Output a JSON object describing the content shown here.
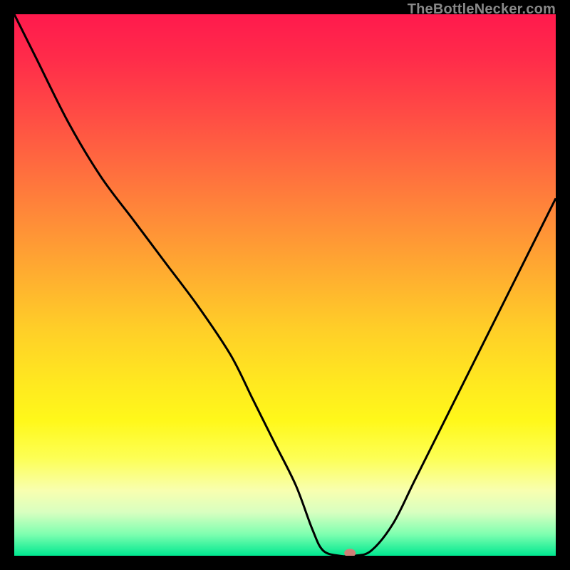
{
  "attribution": "TheBottleNecker.com",
  "chart_data": {
    "type": "line",
    "title": "",
    "xlabel": "",
    "ylabel": "",
    "xlim": [
      0,
      100
    ],
    "ylim": [
      0,
      100
    ],
    "x": [
      0,
      4,
      10,
      16,
      22,
      28,
      34,
      40,
      44,
      48,
      52,
      55,
      57,
      60,
      63,
      66,
      70,
      74,
      80,
      86,
      92,
      100
    ],
    "values": [
      100,
      92,
      80,
      70,
      62,
      54,
      46,
      37,
      29,
      21,
      13,
      5,
      1,
      0,
      0,
      1,
      6,
      14,
      26,
      38,
      50,
      66
    ],
    "marker": {
      "x": 62,
      "y": 0.5
    },
    "colors": {
      "curve": "#000000",
      "marker_fill": "#d08078",
      "gradient_top": "#ff1a4d",
      "gradient_bottom": "#00e890"
    }
  }
}
